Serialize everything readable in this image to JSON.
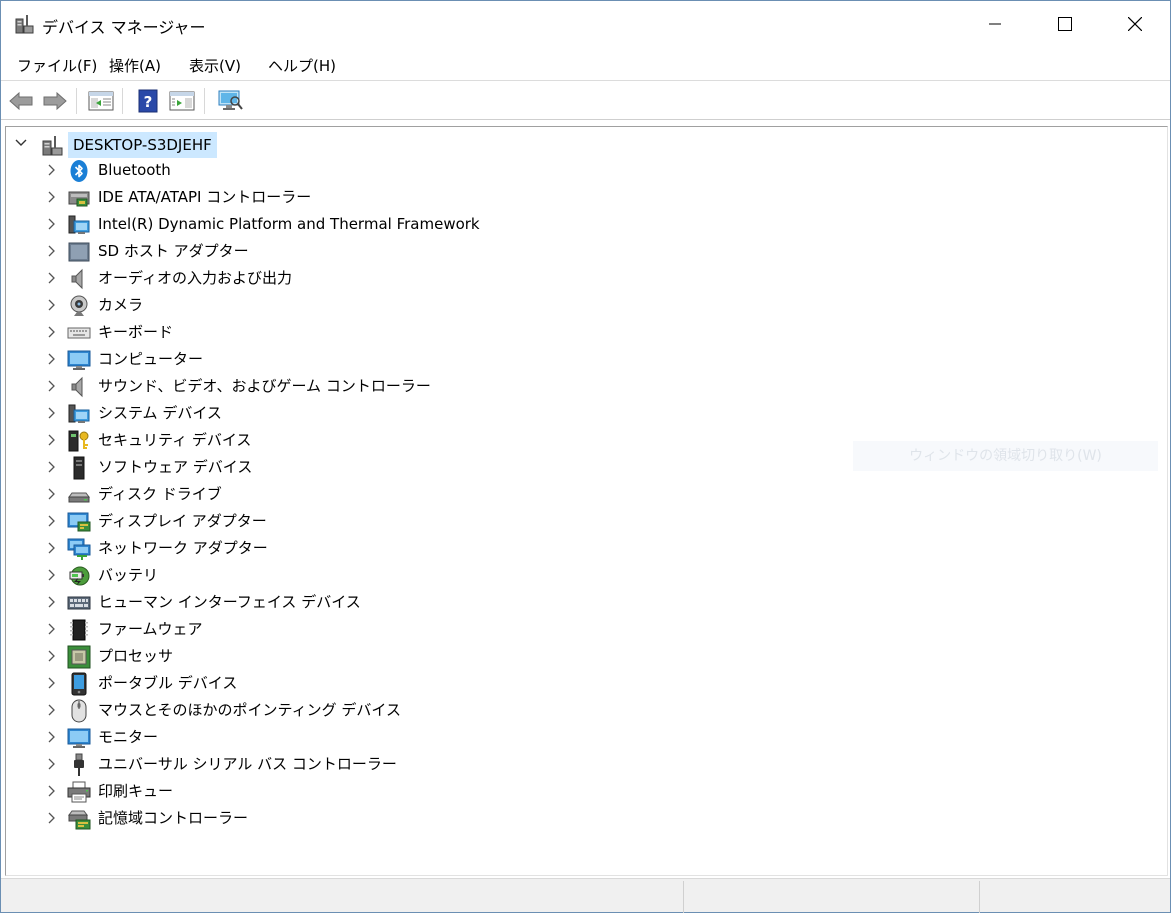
{
  "window": {
    "title": "デバイス マネージャー"
  },
  "menu": {
    "items": [
      {
        "label": "ファイル(F)"
      },
      {
        "label": "操作(A)"
      },
      {
        "label": "表示(V)"
      },
      {
        "label": "ヘルプ(H)"
      }
    ]
  },
  "toolbar": {
    "buttons": [
      "back-arrow-icon",
      "forward-arrow-icon",
      "properties-pane-icon",
      "help-icon",
      "show-hide-console-tree-icon",
      "scan-hardware-icon"
    ]
  },
  "tree": {
    "root": {
      "label": "DESKTOP-S3DJEHF",
      "icon": "computer-tower-icon"
    },
    "items": [
      {
        "label": "Bluetooth",
        "icon": "bluetooth-icon"
      },
      {
        "label": "IDE ATA/ATAPI コントローラー",
        "icon": "ide-controller-icon"
      },
      {
        "label": "Intel(R) Dynamic Platform and Thermal Framework",
        "icon": "system-device-icon"
      },
      {
        "label": "SD ホスト アダプター",
        "icon": "sd-host-adapter-icon"
      },
      {
        "label": "オーディオの入力および出力",
        "icon": "speaker-icon"
      },
      {
        "label": "カメラ",
        "icon": "webcam-icon"
      },
      {
        "label": "キーボード",
        "icon": "keyboard-icon"
      },
      {
        "label": "コンピューター",
        "icon": "monitor-icon"
      },
      {
        "label": "サウンド、ビデオ、およびゲーム コントローラー",
        "icon": "speaker-icon"
      },
      {
        "label": "システム デバイス",
        "icon": "system-device-icon"
      },
      {
        "label": "セキュリティ デバイス",
        "icon": "security-key-icon"
      },
      {
        "label": "ソフトウェア デバイス",
        "icon": "software-device-icon"
      },
      {
        "label": "ディスク ドライブ",
        "icon": "disk-drive-icon"
      },
      {
        "label": "ディスプレイ アダプター",
        "icon": "display-adapter-icon"
      },
      {
        "label": "ネットワーク アダプター",
        "icon": "network-adapter-icon"
      },
      {
        "label": "バッテリ",
        "icon": "battery-icon"
      },
      {
        "label": "ヒューマン インターフェイス デバイス",
        "icon": "hid-icon"
      },
      {
        "label": "ファームウェア",
        "icon": "firmware-chip-icon"
      },
      {
        "label": "プロセッサ",
        "icon": "processor-icon"
      },
      {
        "label": "ポータブル デバイス",
        "icon": "portable-device-icon"
      },
      {
        "label": "マウスとそのほかのポインティング デバイス",
        "icon": "mouse-icon"
      },
      {
        "label": "モニター",
        "icon": "monitor-icon"
      },
      {
        "label": "ユニバーサル シリアル バス コントローラー",
        "icon": "usb-icon"
      },
      {
        "label": "印刷キュー",
        "icon": "printer-icon"
      },
      {
        "label": "記憶域コントローラー",
        "icon": "storage-controller-icon"
      }
    ]
  },
  "ghost_tooltip": "ウィンドウの領域切り取り(W)",
  "colors": {
    "selection": "#cce8ff",
    "border": "#6b8fb3",
    "statusbar": "#f0f0f0"
  }
}
